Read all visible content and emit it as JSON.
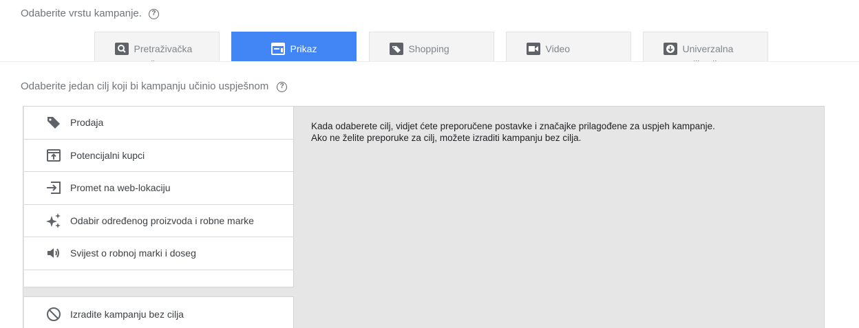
{
  "campaign_type": {
    "label": "Odaberite vrstu kampanje.",
    "help": "?",
    "tabs": [
      {
        "label": "Pretraživačka mreža",
        "icon": "search-icon",
        "active": false
      },
      {
        "label": "Prikaz",
        "icon": "display-icon",
        "active": true
      },
      {
        "label": "Shopping",
        "icon": "tag-icon",
        "active": false
      },
      {
        "label": "Video",
        "icon": "video-icon",
        "active": false
      },
      {
        "label": "Univerzalna aplikacija",
        "icon": "download-icon",
        "active": false
      }
    ]
  },
  "goal": {
    "label": "Odaberite jedan cilj koji bi kampanju učinio uspješnom",
    "help": "?",
    "items": [
      {
        "label": "Prodaja",
        "icon": "tag-icon"
      },
      {
        "label": "Potencijalni kupci",
        "icon": "leads-icon"
      },
      {
        "label": "Promet na web-lokaciju",
        "icon": "website-traffic-icon"
      },
      {
        "label": "Odabir određenog proizvoda i robne marke",
        "icon": "sparkle-icon"
      },
      {
        "label": "Svijest o robnoj marki i doseg",
        "icon": "speaker-icon"
      }
    ],
    "no_goal_label": "Izradite kampanju bez cilja",
    "no_goal_icon": "block-icon",
    "info_line1": "Kada odaberete cilj, vidjet ćete preporučene postavke i značajke prilagođene za uspjeh kampanje.",
    "info_line2": "Ako ne želite preporuke za cilj, možete izraditi kampanju bez cilja."
  },
  "colors": {
    "accent": "#4285f4",
    "panel_bg": "#e6e6e6",
    "tab_bg": "#f4f4f4"
  }
}
